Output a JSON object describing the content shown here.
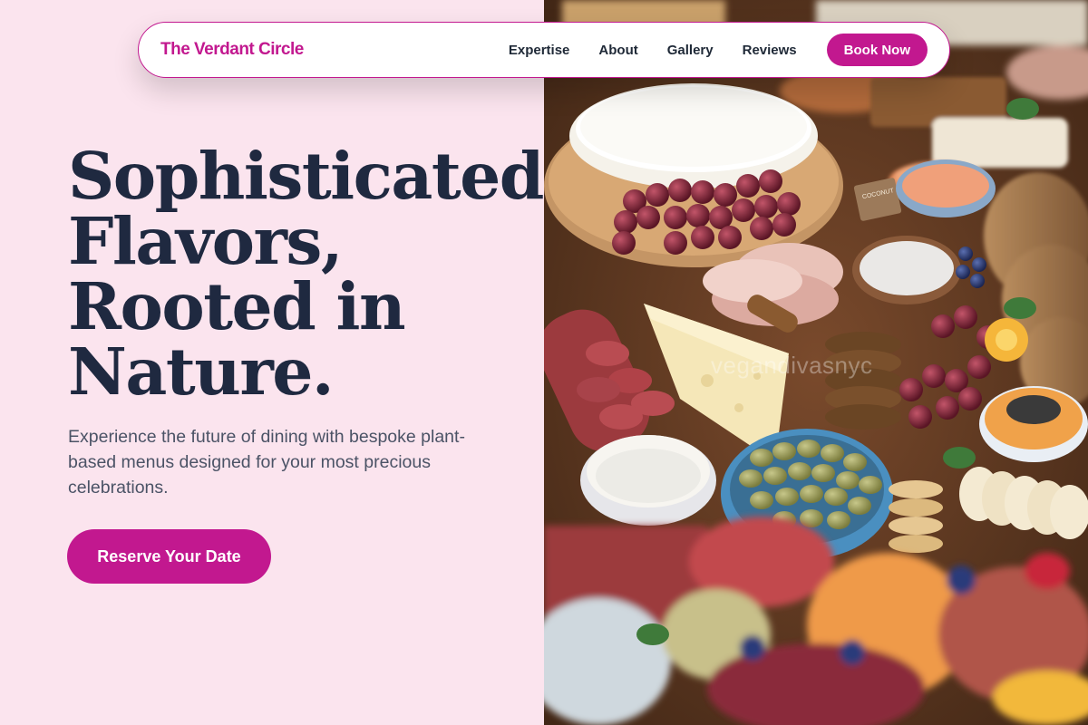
{
  "nav": {
    "brand": "The Verdant Circle",
    "links": [
      "Expertise",
      "About",
      "Gallery",
      "Reviews"
    ],
    "cta": "Book Now"
  },
  "hero": {
    "headline_lines": [
      "Sophisticated",
      "Flavors,",
      "Rooted in",
      "Nature."
    ],
    "subtitle": "Experience the future of dining with bespoke plant-based menus designed for your most precious celebrations.",
    "cta": "Reserve Your Date"
  },
  "image": {
    "watermark": "vegandivasnyc",
    "sign_text": "COCONUT ..."
  },
  "colors": {
    "accent": "#c2188f",
    "background": "#fbe4ee",
    "heading": "#1f2940",
    "body_text": "#4b5366"
  }
}
